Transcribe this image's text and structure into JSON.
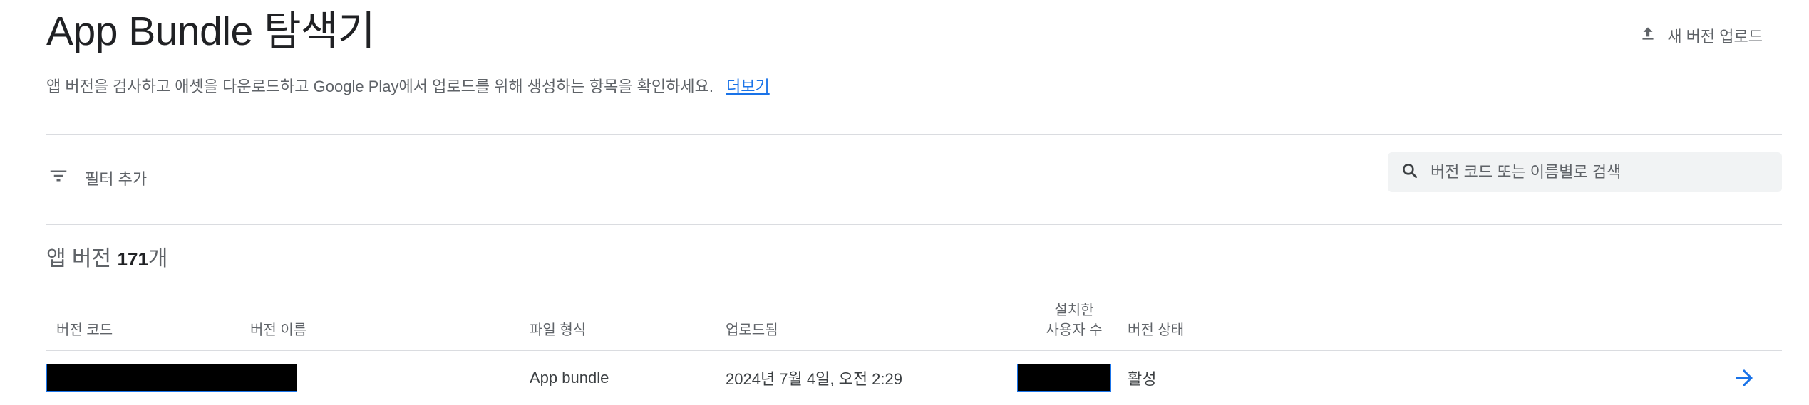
{
  "header": {
    "title": "App Bundle 탐색기",
    "upload_label": "새 버전 업로드",
    "upload_icon": "upload-icon"
  },
  "subtitle": {
    "text": "앱 버전을 검사하고 애셋을 다운로드하고 Google Play에서 업로드를 위해 생성하는 항목을 확인하세요.",
    "link_label": "더보기"
  },
  "filter": {
    "add_filter_label": "필터 추가",
    "icon": "filter-icon"
  },
  "search": {
    "placeholder": "버전 코드 또는 이름별로 검색",
    "icon": "search-icon"
  },
  "versions": {
    "prefix": "앱 버전",
    "count": "171",
    "suffix": "개"
  },
  "table": {
    "columns": {
      "version_code": "버전 코드",
      "version_name": "버전 이름",
      "file_format": "파일 형식",
      "uploaded": "업로드됨",
      "installs_line1": "설치한",
      "installs_line2": "사용자 수",
      "status": "버전 상태"
    },
    "rows": [
      {
        "version_code": "",
        "version_name": "",
        "file_format": "App bundle",
        "uploaded": "2024년 7월 4일, 오전 2:29",
        "installs": "",
        "status": "활성"
      }
    ]
  },
  "colors": {
    "accent": "#1a73e8",
    "text_primary": "#202124",
    "text_secondary": "#5f6368",
    "divider": "#dadce0",
    "search_bg": "#f1f3f4",
    "redacted": "#000000"
  }
}
